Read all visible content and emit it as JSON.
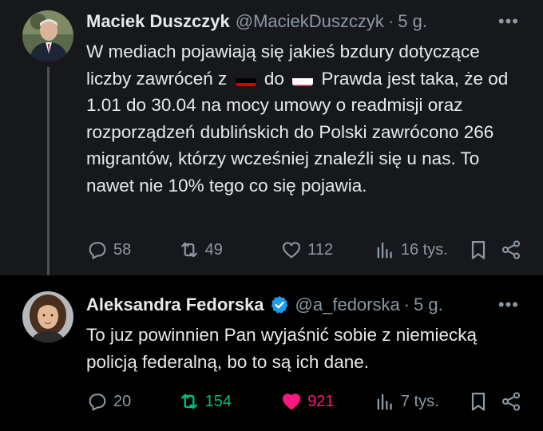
{
  "tweets": [
    {
      "author": {
        "name": "Maciek Duszczyk",
        "handle": "@MaciekDuszczyk",
        "time": "5 g.",
        "verified": false
      },
      "text": {
        "part1": "W mediach pojawiają się jakieś bzdury dotyczące liczby zawróceń z",
        "flag1": "germany-flag",
        "part2": "do",
        "flag2": "poland-flag",
        "part3": "Prawda jest taka, że od 1.01 do 30.04 na mocy umowy o readmisji oraz rozporządzeń dublińskich do Polski zawrócono 266 migrantów, którzy wcześniej znaleźli się u nas. To nawet nie 10% tego co się pojawia."
      },
      "stats": {
        "replies": "58",
        "reposts": "49",
        "likes": "112",
        "views": "16 tys."
      },
      "state": {
        "reposted": false,
        "liked": false
      }
    },
    {
      "author": {
        "name": "Aleksandra Fedorska",
        "handle": "@a_fedorska",
        "time": "5 g.",
        "verified": true
      },
      "text": "To juz powinnien Pan wyjaśnić sobie z niemiecką policją federalną, bo to są ich dane.",
      "stats": {
        "replies": "20",
        "reposts": "154",
        "likes": "921",
        "views": "7 tys."
      },
      "state": {
        "reposted": true,
        "liked": true
      }
    }
  ],
  "ui": {
    "dot": "·",
    "more": "•••"
  },
  "colors": {
    "background_dark": "#000000",
    "background_parent": "#16181c",
    "text": "#e7e9ea",
    "muted": "#8b98a5",
    "repost_active": "#00ba7c",
    "like_active": "#f91880",
    "verified": "#1d9bf0",
    "flag_germany": [
      "#000000",
      "#dd0000",
      "#ffce00"
    ],
    "flag_poland": [
      "#ffffff",
      "#dc143c"
    ]
  }
}
